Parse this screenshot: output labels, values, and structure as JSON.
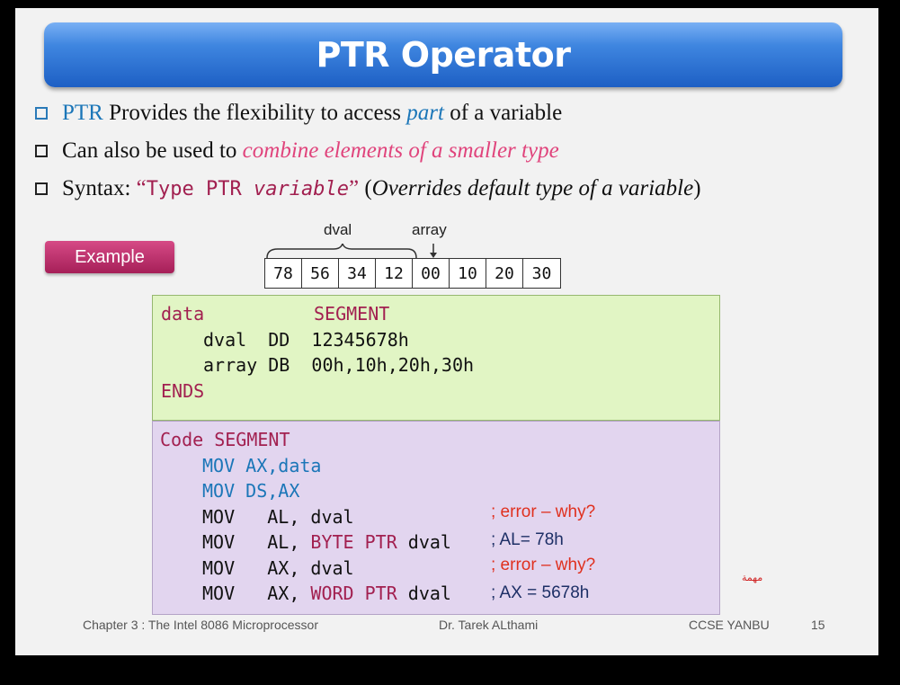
{
  "title": "PTR Operator",
  "bullets": {
    "b1": {
      "ptr": "PTR",
      "text1": " Provides the flexibility to access ",
      "part": "part",
      "text2": " of a variable"
    },
    "b2": {
      "text1": "Can also be used to ",
      "highlight": "combine elements of a smaller type"
    },
    "b3": {
      "text1": "Syntax: ",
      "open_quote": "“",
      "code": "Type PTR ",
      "code_var": "variable",
      "close_quote": "”",
      "paren": " (",
      "note": "Overrides default type of a variable",
      "paren_close": ")"
    }
  },
  "example_label": "Example",
  "memory": {
    "dval_label": "dval",
    "array_label": "array",
    "cells": [
      "78",
      "56",
      "34",
      "12",
      "00",
      "10",
      "20",
      "30"
    ]
  },
  "data_segment": {
    "line1_a": "data",
    "line1_b": "SEGMENT",
    "line2": "dval  DD  12345678h",
    "line3": "array DB  00h,10h,20h,30h",
    "line4": "ENDS"
  },
  "code_segment": {
    "line1": "Code SEGMENT",
    "line2": "MOV AX,data",
    "line3": "MOV DS,AX",
    "line4": "MOV   AL, dval",
    "line5_a": "MOV   AL, ",
    "line5_b": "BYTE PTR",
    "line5_c": " dval",
    "line6": "MOV   AX, dval",
    "line7_a": "MOV   AX, ",
    "line7_b": "WORD PTR",
    "line7_c": " dval",
    "comment4": "; error – why?",
    "comment5": "; AL= 78h",
    "comment6": "; error – why?",
    "comment7": "; AX = 5678h"
  },
  "arabic_note": "مهمة",
  "footer": {
    "chapter": "Chapter 3 : The Intel  8086  Microprocessor",
    "author": "Dr. Tarek  ALthami",
    "org": "CCSE  YANBU",
    "page": "15"
  }
}
